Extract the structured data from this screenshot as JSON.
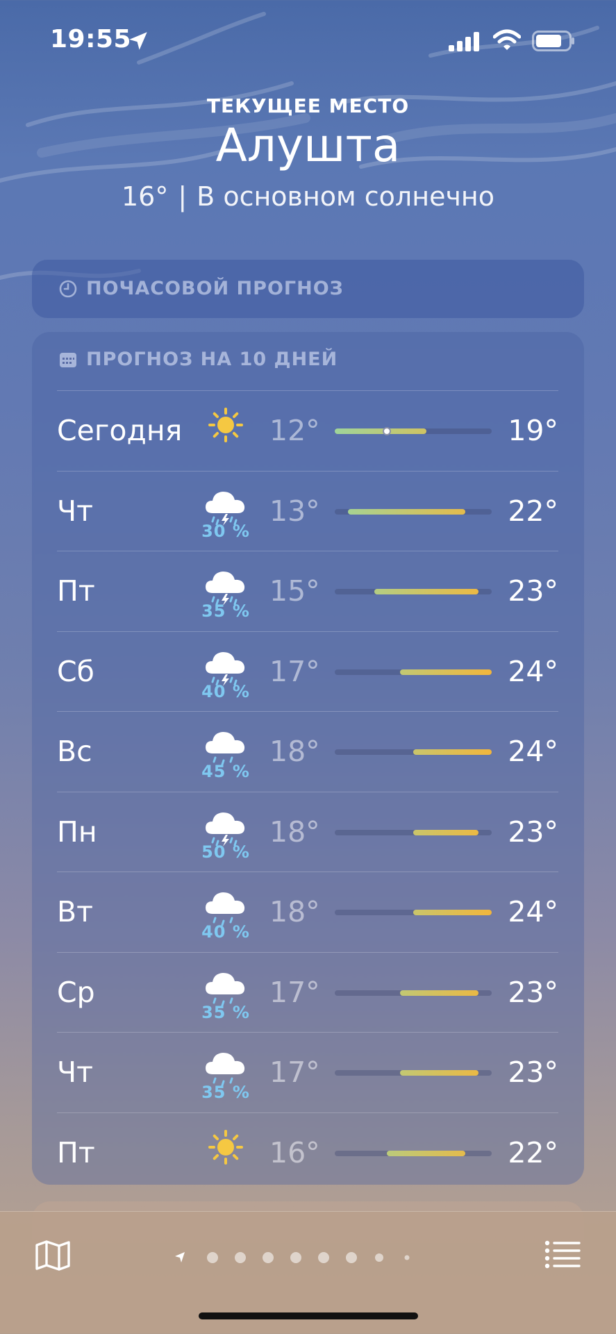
{
  "status_bar": {
    "time": "19:55"
  },
  "header": {
    "location_label": "ТЕКУЩЕЕ МЕСТО",
    "city": "Алушта",
    "current_temp": "16°",
    "separator": "|",
    "condition": "В основном солнечно"
  },
  "hourly": {
    "title": "ПОЧАСОВОЙ ПРОГНОЗ",
    "icon": "clock-icon"
  },
  "daily": {
    "title": "ПРОГНОЗ НА 10 ДНЕЙ",
    "icon": "calendar-icon",
    "days": [
      {
        "day": "Сегодня",
        "icon": "sun-icon",
        "precip": "",
        "low": "12°",
        "high": "19°",
        "current": "16°"
      },
      {
        "day": "Чт",
        "icon": "cloud-thunder-rain-icon",
        "precip": "30 %",
        "low": "13°",
        "high": "22°"
      },
      {
        "day": "Пт",
        "icon": "cloud-thunder-rain-icon",
        "precip": "35 %",
        "low": "15°",
        "high": "23°"
      },
      {
        "day": "Сб",
        "icon": "cloud-thunder-rain-icon",
        "precip": "40 %",
        "low": "17°",
        "high": "24°"
      },
      {
        "day": "Вс",
        "icon": "cloud-rain-icon",
        "precip": "45 %",
        "low": "18°",
        "high": "24°"
      },
      {
        "day": "Пн",
        "icon": "cloud-thunder-rain-icon",
        "precip": "50 %",
        "low": "18°",
        "high": "23°"
      },
      {
        "day": "Вт",
        "icon": "cloud-rain-icon",
        "precip": "40 %",
        "low": "18°",
        "high": "24°"
      },
      {
        "day": "Ср",
        "icon": "cloud-rain-icon",
        "precip": "35 %",
        "low": "17°",
        "high": "23°"
      },
      {
        "day": "Чт",
        "icon": "cloud-rain-icon",
        "precip": "35 %",
        "low": "17°",
        "high": "23°"
      },
      {
        "day": "Пт",
        "icon": "sun-icon",
        "precip": "",
        "low": "16°",
        "high": "22°"
      }
    ]
  },
  "toolbar": {
    "left_icon": "map-icon",
    "right_icon": "list-icon",
    "pages": 9,
    "active_page": 0
  },
  "colors": {
    "sun": "#f5c842",
    "precip": "#7fc8f0",
    "cool": "#9fd49a",
    "warm": "#f2b63c"
  }
}
